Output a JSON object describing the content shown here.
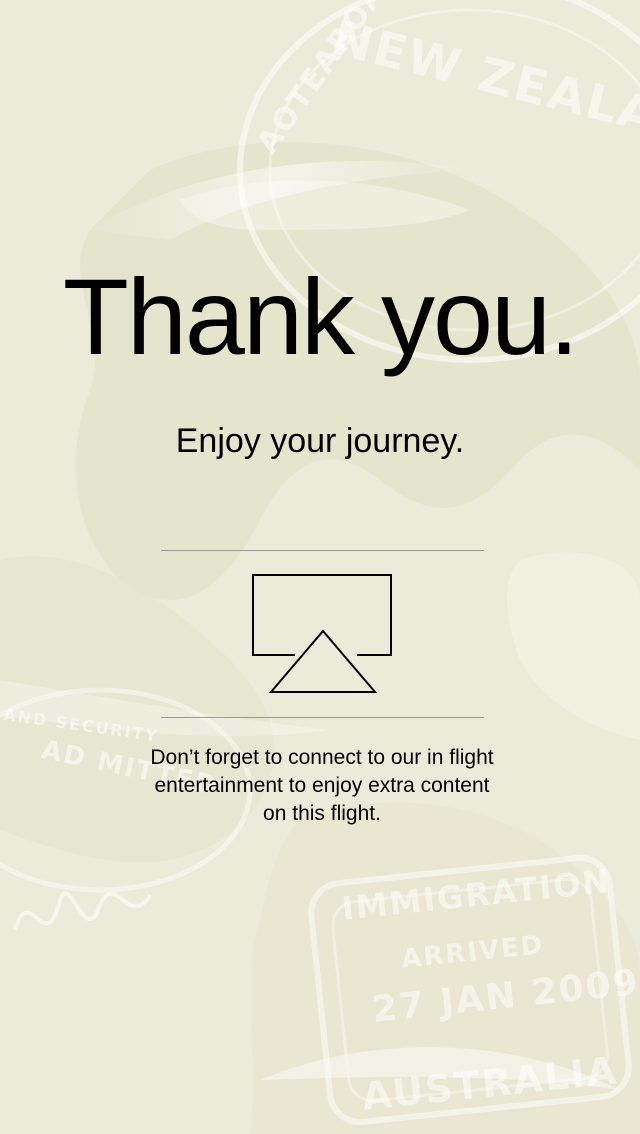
{
  "background": {
    "base_color": "#ecebd9",
    "stamps": [
      {
        "text": "NEW ZEALAND"
      },
      {
        "text": "AOTEAROA"
      },
      {
        "text": "IMMIGRATION"
      },
      {
        "text": "ARRIVED"
      },
      {
        "text": "27 JAN 2009"
      },
      {
        "text": "AUSTRALIA"
      },
      {
        "text": "AD MITTED"
      },
      {
        "text": "AND SECURITY"
      }
    ]
  },
  "header": {
    "title": "Thank you.",
    "subtitle": "Enjoy your journey."
  },
  "entertainment": {
    "icon": "airplay-icon",
    "message": "Don’t forget to connect to our in flight entertainment to enjoy extra content on this flight."
  }
}
